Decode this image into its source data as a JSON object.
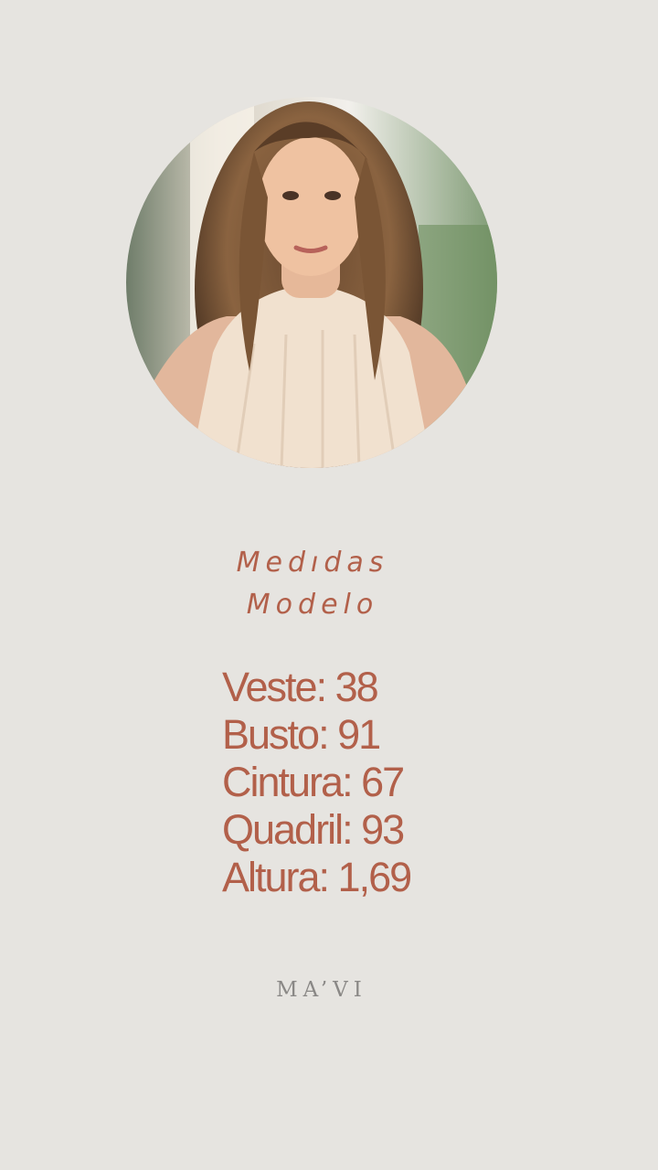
{
  "profile": {
    "photo_alt": "model-photo"
  },
  "title": {
    "line1": "Medıdas",
    "line2": "Modelo"
  },
  "measurements": [
    "Veste: 38",
    "Busto: 91",
    "Cintura: 67",
    "Quadril: 93",
    "Altura: 1,69"
  ],
  "brand": {
    "name": "MA’VI"
  },
  "colors": {
    "background": "#e6e4e0",
    "accent": "#b2604a",
    "brand": "#8a8886"
  }
}
